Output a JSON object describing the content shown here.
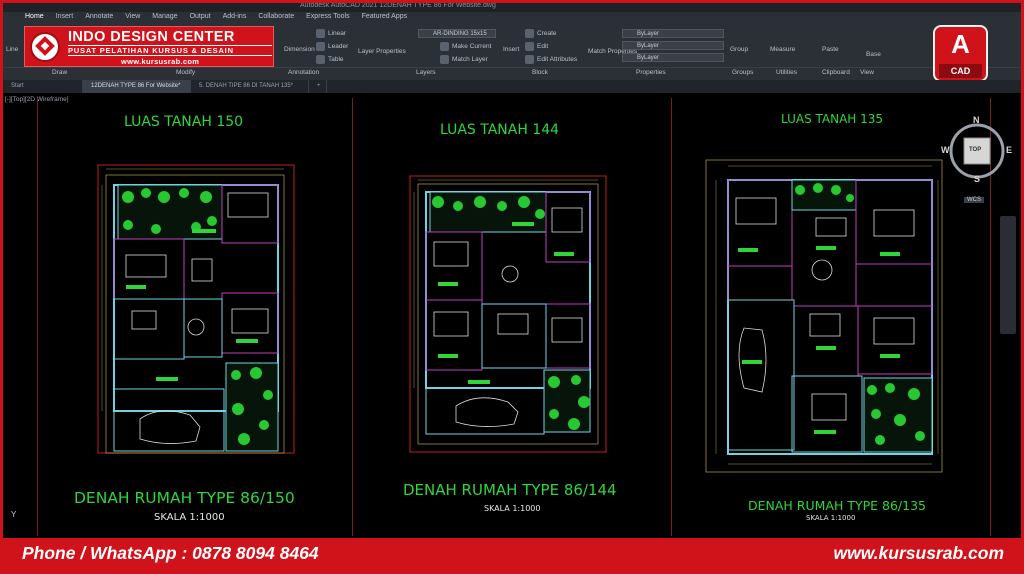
{
  "window": {
    "title": "Autodesk AutoCAD 2021   12DENAH TYPE 86 For Website.dwg"
  },
  "ribbon": {
    "tabs": [
      "Home",
      "Insert",
      "Annotate",
      "View",
      "Manage",
      "Output",
      "Add-ins",
      "Collaborate",
      "Express Tools",
      "Featured Apps"
    ],
    "items": {
      "line": "Line",
      "linear": "Linear",
      "leader": "Leader",
      "table": "Table",
      "dimension": "Dimension",
      "layer_properties": "Layer Properties",
      "layer_combo": "AR-DINDING 15x15",
      "make_current": "Make Current",
      "match_layer": "Match Layer",
      "insert": "Insert",
      "create": "Create",
      "edit": "Edit",
      "edit_attributes": "Edit Attributes",
      "match_properties": "Match Properties",
      "bylayer_1": "ByLayer",
      "bylayer_2": "ByLayer",
      "bylayer_3": "ByLayer",
      "group": "Group",
      "measure": "Measure",
      "paste": "Paste",
      "base": "Base"
    },
    "panels": [
      "Draw",
      "Modify",
      "Annotation",
      "Layers",
      "Block",
      "Properties",
      "Groups",
      "Utilities",
      "Clipboard",
      "View"
    ]
  },
  "logo": {
    "title": "INDO DESIGN CENTER",
    "subtitle": "PUSAT PELATIHAN KURSUS & DESAIN",
    "url": "www.kursusrab.com"
  },
  "cad_badge": {
    "letter": "A",
    "label": "CAD"
  },
  "doc_tabs": [
    "Start",
    "12DENAH TYPE 86 For Website*",
    "5. DENAH TIPE 86 DI TANAH 135*",
    "+"
  ],
  "viewport_label": "[-][Top][2D Wireframe]",
  "navcube": {
    "n": "N",
    "s": "S",
    "e": "E",
    "w": "W",
    "top": "TOP",
    "wcs": "WCS"
  },
  "plans": [
    {
      "area_title": "LUAS TANAH 150",
      "name": "DENAH RUMAH TYPE 86/150",
      "scale": "SKALA 1:1000"
    },
    {
      "area_title": "LUAS TANAH 144",
      "name": "DENAH RUMAH TYPE 86/144",
      "scale": "SKALA 1:1000"
    },
    {
      "area_title": "LUAS TANAH 135",
      "name": "DENAH RUMAH TYPE 86/135",
      "scale": "SKALA 1:1000"
    }
  ],
  "axis_y": "Y",
  "footer": {
    "phone": "Phone / WhatsApp : 0878 8094 8464",
    "website": "www.kursusrab.com"
  },
  "colors": {
    "brand_red": "#d0121b",
    "cad_green": "#2fd63a",
    "wall_cyan": "#6fd3e0",
    "wall_magenta": "#c040c0"
  }
}
